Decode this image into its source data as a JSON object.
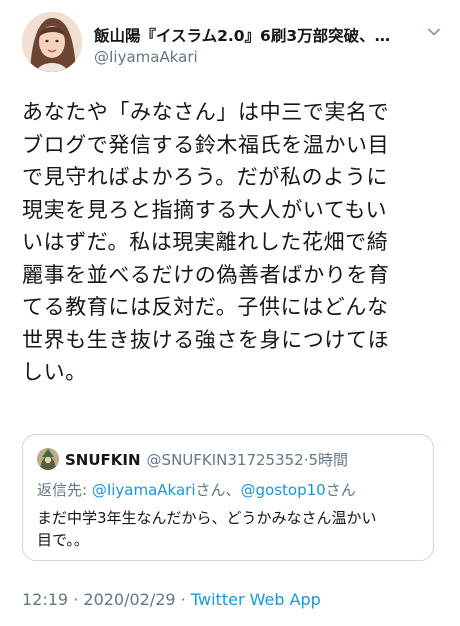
{
  "author": {
    "display_name": "飯山陽『イスラム2.0』6刷3万部突破、…",
    "handle": "@IiyamaAkari"
  },
  "body_lines": [
    "あなたや「みなさん」は中三で実名で",
    "ブログで発信する鈴木福氏を温かい目",
    "で見守ればよかろう。だが私のように",
    "現実を見ろと指摘する大人がいてもい",
    "いはずだ。私は現実離れした花畑で綺",
    "麗事を並べるだけの偽善者ばかりを育",
    "てる教育には反対だ。子供にはどんな",
    "世界も生き抜ける強さを身につけてほ",
    "しい。"
  ],
  "quote": {
    "name": "SNUFKIN",
    "handle": "@SNUFKIN31725352",
    "separator": "·",
    "time": "5時間",
    "reply_prefix": "返信先: ",
    "reply_mention1": "@IiyamaAkari",
    "reply_mid": "さん、",
    "reply_mention2": "@gostop10",
    "reply_suffix": "さん",
    "text_lines": [
      "まだ中学3年生なんだから、どうかみなさん温かい",
      "目で。。"
    ]
  },
  "meta": {
    "time": "12:19",
    "separator": "·",
    "date": "2020/02/29",
    "app": "Twitter Web App"
  },
  "icons": {
    "more": "chevron-down-icon",
    "avatar": "avatar",
    "quote_avatar": "avatar"
  },
  "colors": {
    "text": "#14171a",
    "secondary": "#657786",
    "link": "#1b95e0",
    "border": "#ccd6dd"
  }
}
